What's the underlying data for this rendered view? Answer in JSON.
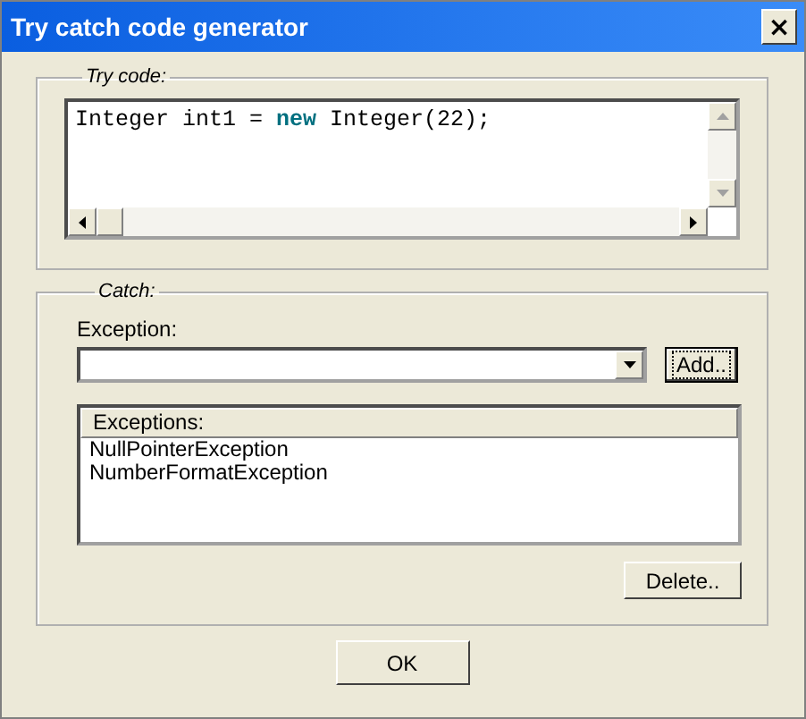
{
  "window": {
    "title": "Try catch code generator",
    "close": "×"
  },
  "try_group": {
    "legend": "Try code:",
    "code_line": [
      {
        "text": "Integer int1 = ",
        "kind": "plain"
      },
      {
        "text": "new",
        "kind": "keyword"
      },
      {
        "text": " Integer(22);",
        "kind": "plain"
      }
    ]
  },
  "catch_group": {
    "legend": "Catch:",
    "exception_label": "Exception:",
    "add_button": "Add..",
    "list_header": "Exceptions:",
    "exceptions": [
      "NullPointerException",
      "NumberFormatException"
    ],
    "delete_button": "Delete.."
  },
  "ok_button": "OK"
}
